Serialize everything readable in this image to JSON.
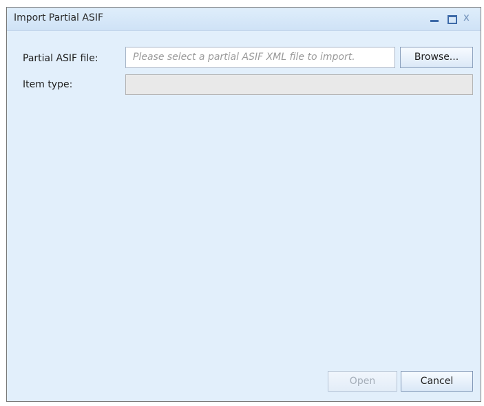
{
  "window": {
    "title": "Import Partial ASIF",
    "minimize_icon": "minimize-icon",
    "maximize_icon": "maximize-icon",
    "close_glyph": "x"
  },
  "form": {
    "file_label": "Partial ASIF file:",
    "file_placeholder": "Please select a partial ASIF XML file to import.",
    "file_value": "",
    "browse_label": "Browse...",
    "type_label": "Item type:",
    "type_value": ""
  },
  "footer": {
    "open_label": "Open",
    "open_enabled": false,
    "cancel_label": "Cancel"
  }
}
